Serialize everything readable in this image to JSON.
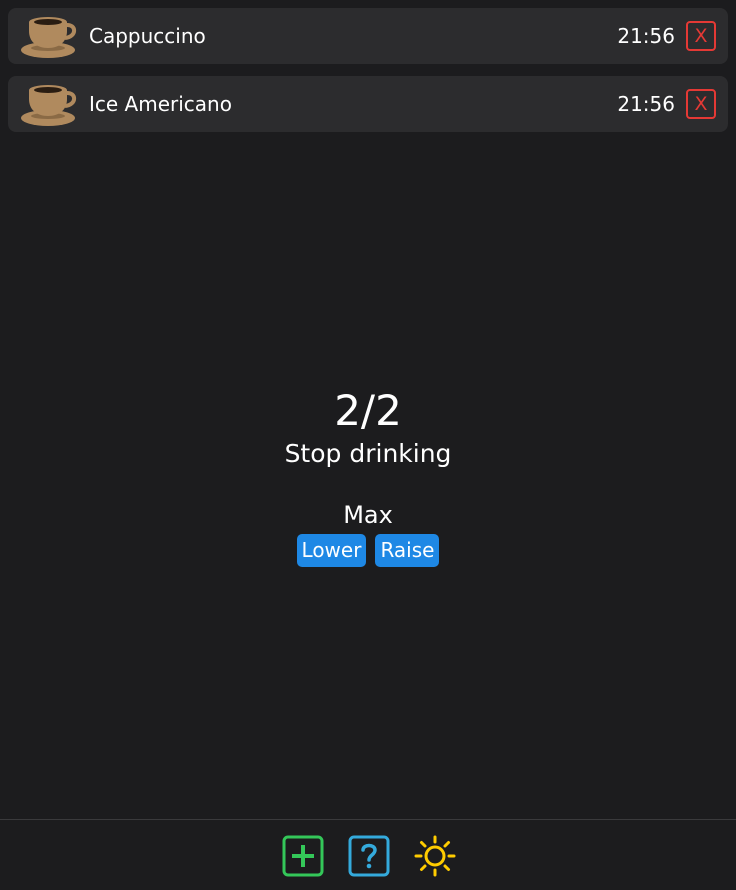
{
  "entries": [
    {
      "name": "Cappuccino",
      "time": "21:56",
      "delete_label": "X",
      "icon": "coffee-cup-icon"
    },
    {
      "name": "Ice Americano",
      "time": "21:56",
      "delete_label": "X",
      "icon": "coffee-cup-icon"
    }
  ],
  "summary": {
    "count": "2/2",
    "status": "Stop drinking"
  },
  "limit": {
    "label": "Max",
    "lower_label": "Lower",
    "raise_label": "Raise"
  },
  "toolbar": {
    "add_icon": "plus-icon",
    "help_icon": "question-icon",
    "theme_icon": "sun-icon"
  },
  "colors": {
    "background": "#1c1c1e",
    "card": "#2c2c2e",
    "delete": "#e53935",
    "accent_blue": "#1e88e5",
    "add_green": "#34c759",
    "help_blue": "#34aadc",
    "sun_yellow": "#ffcc00",
    "cup_brown": "#b08a5e"
  }
}
